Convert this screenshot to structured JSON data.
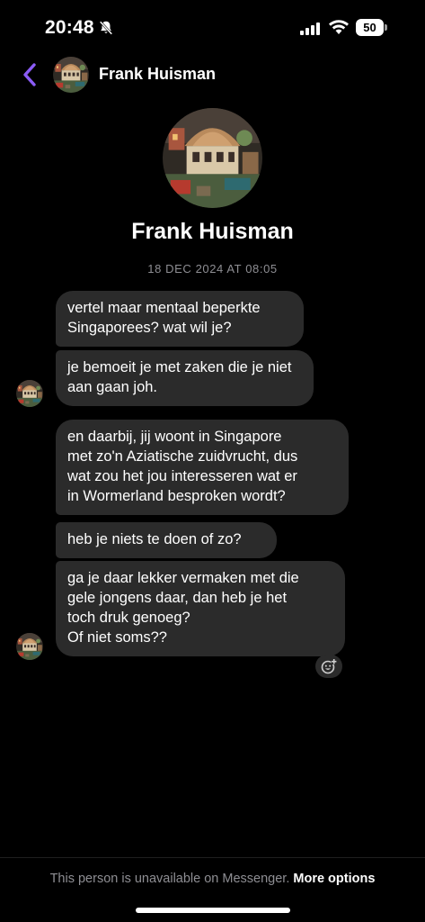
{
  "status_bar": {
    "time": "20:48",
    "battery": "50",
    "icons": [
      "bell-slash-icon",
      "signal-icon",
      "wifi-icon",
      "battery-icon"
    ]
  },
  "header": {
    "contact_name": "Frank Huisman",
    "back_icon": "chevron-left-icon",
    "accent_color": "#8b5cf6"
  },
  "profile": {
    "name": "Frank Huisman",
    "timestamp": "18 DEC 2024 AT 08:05"
  },
  "messages": [
    {
      "text": "vertel maar mentaal beperkte\nSingaporees? wat wil je?"
    },
    {
      "text": "je bemoeit je met zaken die je niet\naan gaan joh."
    },
    {
      "text": "en daarbij, jij woont in Singapore\nmet zo'n Aziatische zuidvrucht, dus\nwat zou het jou interesseren wat er\nin Wormerland besproken wordt?"
    },
    {
      "text": "heb je niets te doen of zo?"
    },
    {
      "text": "ga je daar lekker vermaken met die\ngele jongens daar, dan heb je het\ntoch druk genoeg?\nOf niet soms??"
    }
  ],
  "reaction_icon": "add-reaction-icon",
  "footer": {
    "text": "This person is unavailable on Messenger.",
    "link": "More options"
  },
  "colors": {
    "background": "#000000",
    "bubble": "#2b2b2b",
    "muted_text": "#8e8e93"
  }
}
